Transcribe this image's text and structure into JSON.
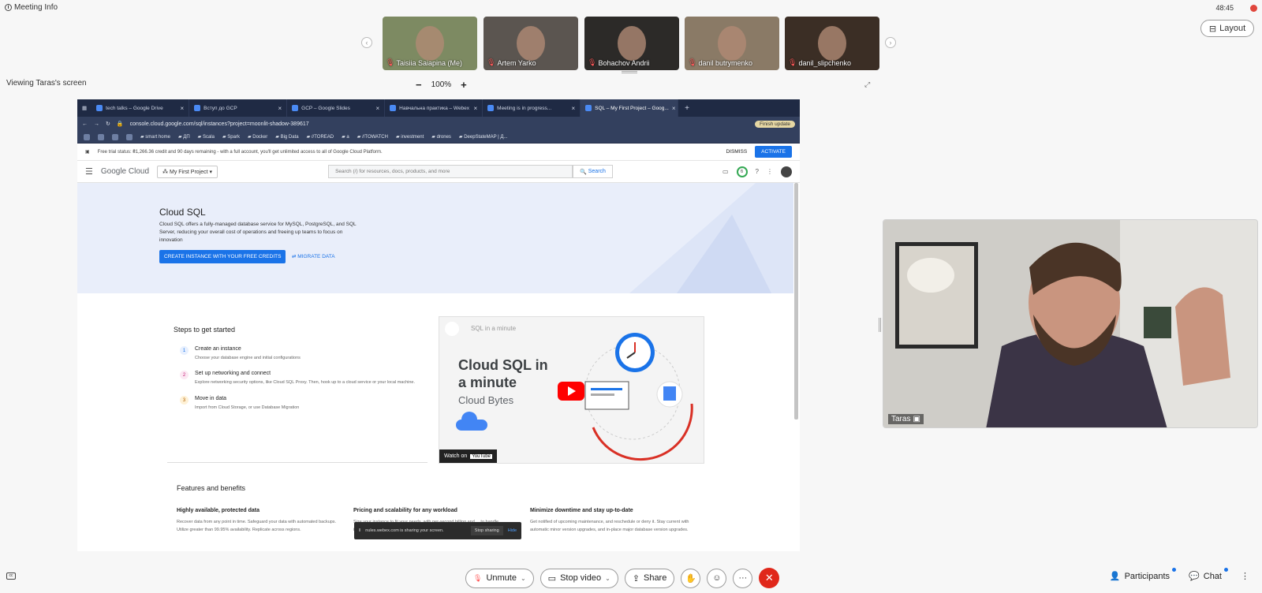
{
  "meeting": {
    "info_label": "Meeting Info",
    "time": "48:45",
    "layout_label": "Layout",
    "viewing_label": "Viewing Taras's screen",
    "zoom": "100%",
    "zoom_minus": "−",
    "zoom_plus": "+"
  },
  "participants_strip": [
    {
      "name": "Taisiia Saiapina (Me)",
      "bg": "#7d8a62"
    },
    {
      "name": "Artem Yarko",
      "bg": "#5b5550"
    },
    {
      "name": "Bohachov Andrii",
      "bg": "#2c2a28"
    },
    {
      "name": "danil butrymenko",
      "bg": "#8a7a66"
    },
    {
      "name": "danil_slipchenko",
      "bg": "#3b2e25"
    }
  ],
  "browser": {
    "tabs": [
      {
        "label": "tech talks – Google Drive"
      },
      {
        "label": "Вступ до GCP"
      },
      {
        "label": "GCP – Google Slides"
      },
      {
        "label": "Навчальна практика – Webex"
      },
      {
        "label": "Meeting is in progress..."
      },
      {
        "label": "SQL – My First Project – Goog..."
      }
    ],
    "url": "console.cloud.google.com/sql/instances?project=moonlit-shadow-389617",
    "finish_update": "Finish update",
    "bookmarks": [
      "smart home",
      "ДП",
      "Scala",
      "Spark",
      "Docker",
      "Big Data",
      "//TOREAD",
      "a",
      "//TOWATCH",
      "investment",
      "drones",
      "DeepStateMAP | Д..."
    ]
  },
  "console": {
    "banner_text": "Free trial status: ₴1,266.36 credit and 90 days remaining - with a full account, you'll get unlimited access to all of Google Cloud Platform.",
    "dismiss": "DISMISS",
    "activate": "ACTIVATE",
    "logo": "Google Cloud",
    "project": "My First Project",
    "search_placeholder": "Search (/) for resources, docs, products, and more",
    "search_button": "Search",
    "notif_count": "6",
    "hero_title": "Cloud SQL",
    "hero_desc": "Cloud SQL offers a fully-managed database service for MySQL, PostgreSQL, and SQL Server, reducing your overall cost of operations and freeing up teams to focus on innovation",
    "cta": "CREATE INSTANCE WITH YOUR FREE CREDITS",
    "migrate": "MIGRATE DATA",
    "steps_title": "Steps to get started",
    "steps": [
      {
        "num": "1",
        "title": "Create an instance",
        "desc": "Choose your database engine and initial configurations",
        "color": "#e8f0fe",
        "fg": "#1a73e8"
      },
      {
        "num": "2",
        "title": "Set up networking and connect",
        "desc": "Explore networking security options, like Cloud SQL Proxy. Then, hook up to a cloud service or your local machine.",
        "color": "#fce8f3",
        "fg": "#c5237a"
      },
      {
        "num": "3",
        "title": "Move in data",
        "desc": "Import from Cloud Storage, or use Database Migration",
        "color": "#fef1d6",
        "fg": "#b06000"
      }
    ],
    "video_top": "SQL in a minute",
    "video_title_1": "Cloud SQL in",
    "video_title_2": "a minute",
    "video_sub": "Cloud Bytes",
    "watch_on": "Watch on",
    "youtube": "YouTube",
    "features_title": "Features and benefits",
    "features": [
      {
        "title": "Highly available, protected data",
        "desc": "Recover data from any point in time. Safeguard your data with automated backups. Utilize greater than 99.95% availability. Replicate across regions."
      },
      {
        "title": "Pricing and scalability for any workload",
        "desc": "Size your instance to fit your needs, with per-second billing and ... to handle increasing read traffic."
      },
      {
        "title": "Minimize downtime and stay up-to-date",
        "desc": "Get notified of upcoming maintenance, and reschedule or deny it. Stay current with automatic minor version upgrades, and in-place major database version upgrades."
      }
    ],
    "share_toast": "nules.webex.com is sharing your screen.",
    "stop_sharing": "Stop sharing",
    "hide": "Hide"
  },
  "presenter": {
    "name": "Taras"
  },
  "toolbar": {
    "unmute": "Unmute",
    "stop_video": "Stop video",
    "share": "Share",
    "participants": "Participants",
    "chat": "Chat"
  }
}
